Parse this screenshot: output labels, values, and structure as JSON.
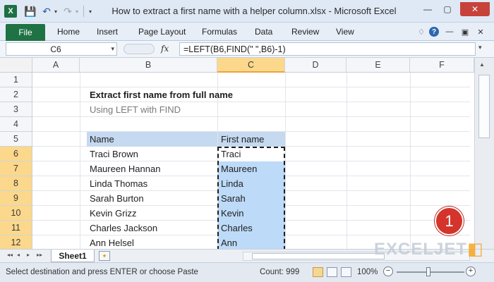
{
  "window": {
    "title": "How to extract a first name with a helper column.xlsx - Microsoft Excel",
    "app_icon": "X",
    "app_icon_name": "excel-icon",
    "close": "✕",
    "minimize": "—",
    "maximize": "▢"
  },
  "qat": {
    "save": "💾",
    "undo": "↶",
    "redo": "↷",
    "dropdown": "▾"
  },
  "ribbon": {
    "file": "File",
    "tabs": [
      "Home",
      "Insert",
      "Page Layout",
      "Formulas",
      "Data",
      "Review",
      "View"
    ],
    "collapse": "♢",
    "help": "?",
    "wb_min": "—",
    "wb_restore": "▣",
    "wb_close": "✕"
  },
  "formula_bar": {
    "name_box": "C6",
    "fx": "fx",
    "formula": "=LEFT(B6,FIND(\" \",B6)-1)"
  },
  "columns": [
    "A",
    "B",
    "C",
    "D",
    "E",
    "F"
  ],
  "rows": [
    "1",
    "2",
    "3",
    "4",
    "5",
    "6",
    "7",
    "8",
    "9",
    "10",
    "11",
    "12"
  ],
  "active_cell": "C6",
  "sheet": {
    "title": "Extract first name from full name",
    "subtitle": "Using LEFT with FIND",
    "headers": {
      "name": "Name",
      "first_name": "First name"
    },
    "records": [
      {
        "name": "Traci Brown",
        "first": "Traci"
      },
      {
        "name": "Maureen Hannan",
        "first": "Maureen"
      },
      {
        "name": "Linda Thomas",
        "first": "Linda"
      },
      {
        "name": "Sarah Burton",
        "first": "Sarah"
      },
      {
        "name": "Kevin Grizz",
        "first": "Kevin"
      },
      {
        "name": "Charles Jackson",
        "first": "Charles"
      },
      {
        "name": "Ann Helsel",
        "first": "Ann"
      }
    ]
  },
  "badge": "1",
  "sheet_tabs": {
    "nav": [
      "◂◂",
      "◂",
      "▸",
      "▸▸"
    ],
    "active": "Sheet1",
    "new_sheet": "✦"
  },
  "watermark": {
    "main": "EXCELJET",
    "mark": "◧"
  },
  "status": {
    "message": "Select destination and press ENTER or choose Paste",
    "count": "Count: 999",
    "zoom": "100%",
    "zoom_out": "−",
    "zoom_in": "+"
  },
  "colors": {
    "file_tab": "#1f7244",
    "header_fill": "#c5d9f0",
    "highlight_fill": "#bddaf8",
    "selected_header": "#fbd88b",
    "badge": "#d4342b"
  }
}
